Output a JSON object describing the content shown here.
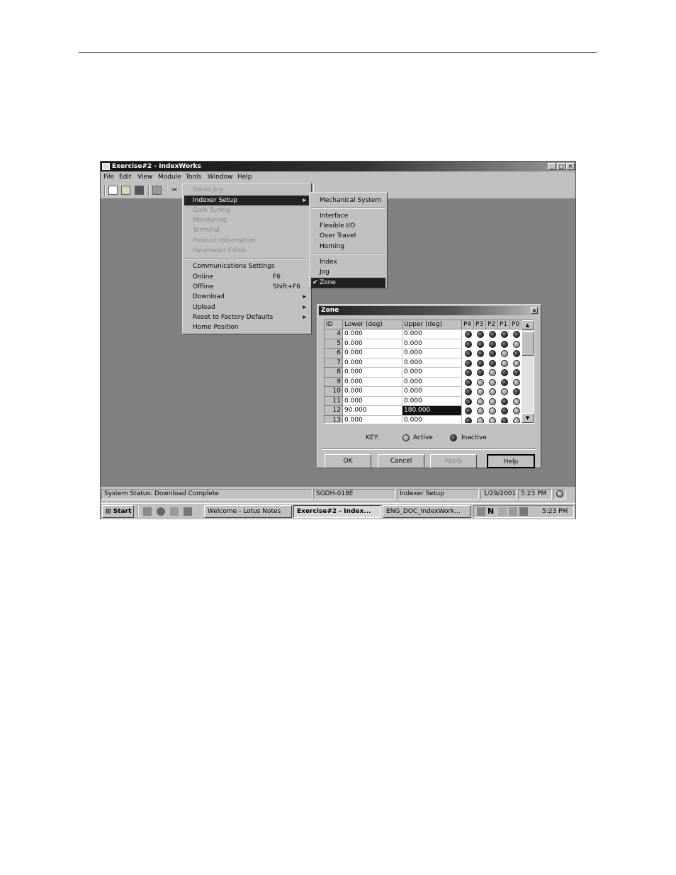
{
  "window": {
    "title": "Exercise#2 - IndexWorks",
    "controls": {
      "minimize": "_",
      "maximize": "□",
      "close": "×"
    }
  },
  "menubar": [
    "File",
    "Edit",
    "View",
    "Module",
    "Tools",
    "Window",
    "Help"
  ],
  "tools_menu": {
    "items": [
      {
        "label": "Servo Jog",
        "disabled": true
      },
      {
        "label": "Indexer Setup",
        "selected": true,
        "submenu": true
      },
      {
        "label": "Gain Tuning",
        "disabled": true
      },
      {
        "label": "Monitoring",
        "disabled": true
      },
      {
        "label": "Terminal",
        "disabled": true
      },
      {
        "label": "Product Information",
        "disabled": true
      },
      {
        "label": "Parameter Editor",
        "disabled": true
      },
      {
        "label": "Communications Settings"
      },
      {
        "label": "Online",
        "shortcut": "F6"
      },
      {
        "label": "Offline",
        "shortcut": "Shift+F6"
      },
      {
        "label": "Download",
        "submenu": true
      },
      {
        "label": "Upload",
        "submenu": true
      },
      {
        "label": "Reset to Factory Defaults",
        "submenu": true
      },
      {
        "label": "Home Position"
      }
    ]
  },
  "indexer_submenu": {
    "items": [
      {
        "label": "Mechanical System"
      },
      {
        "label": "Interface"
      },
      {
        "label": "Flexible I/O"
      },
      {
        "label": "Over Travel"
      },
      {
        "label": "Homing"
      },
      {
        "label": "Index"
      },
      {
        "label": "Jog"
      },
      {
        "label": "Zone",
        "checked": true,
        "selected": true
      }
    ]
  },
  "zone_dialog": {
    "title": "Zone",
    "close": "×",
    "headers": [
      "ID",
      "Lower (deg)",
      "Upper (deg)",
      "P4",
      "P3",
      "P2",
      "P1",
      "P0"
    ],
    "rows": [
      {
        "id": "4",
        "lower": "0.000",
        "upper": "0.000",
        "leds": [
          0,
          0,
          0,
          0,
          0
        ]
      },
      {
        "id": "5",
        "lower": "0.000",
        "upper": "0.000",
        "leds": [
          0,
          0,
          0,
          0,
          1
        ]
      },
      {
        "id": "6",
        "lower": "0.000",
        "upper": "0.000",
        "leds": [
          0,
          0,
          0,
          1,
          0
        ]
      },
      {
        "id": "7",
        "lower": "0.000",
        "upper": "0.000",
        "leds": [
          0,
          0,
          0,
          1,
          1
        ]
      },
      {
        "id": "8",
        "lower": "0.000",
        "upper": "0.000",
        "leds": [
          0,
          0,
          1,
          0,
          0
        ]
      },
      {
        "id": "9",
        "lower": "0.000",
        "upper": "0.000",
        "leds": [
          0,
          1,
          1,
          0,
          1
        ]
      },
      {
        "id": "10",
        "lower": "0.000",
        "upper": "0.000",
        "leds": [
          0,
          1,
          1,
          1,
          0
        ]
      },
      {
        "id": "11",
        "lower": "0.000",
        "upper": "0.000",
        "leds": [
          0,
          1,
          1,
          0,
          1
        ]
      },
      {
        "id": "12",
        "lower": "90.000",
        "upper": "180.000",
        "leds": [
          0,
          1,
          1,
          0,
          1
        ],
        "highlight_upper": true
      },
      {
        "id": "13",
        "lower": "0.000",
        "upper": "0.000",
        "leds": [
          0,
          1,
          1,
          0,
          1
        ]
      }
    ],
    "key_label": "KEY:",
    "key_active": "Active",
    "key_inactive": "Inactive",
    "buttons": {
      "ok": "OK",
      "cancel": "Cancel",
      "apply": "Apply",
      "help": "Help"
    }
  },
  "statusbar": {
    "status": "System Status: Download Complete",
    "device": "SGDH-018E",
    "mode": "Indexer Setup",
    "date": "1/29/2001",
    "time": "5:23 PM"
  },
  "taskbar": {
    "start": "Start",
    "tasks": [
      "Welcome - Lotus Notes",
      "Exercise#2 - Index...",
      "ENG_DOC_IndexWork..."
    ],
    "clock": "5:23 PM"
  },
  "icons": {
    "app": "indexworks-app-icon",
    "toolbar": [
      "new-file-icon",
      "open-folder-icon",
      "save-icon",
      "print-icon",
      "cut-icon"
    ],
    "quick_launch": [
      "desktop-icon",
      "browser-icon",
      "outlook-icon",
      "notes-icon"
    ],
    "tray": [
      "network-icon",
      "notes-tray-icon",
      "mail-icon",
      "volume-icon",
      "printer-icon"
    ]
  }
}
